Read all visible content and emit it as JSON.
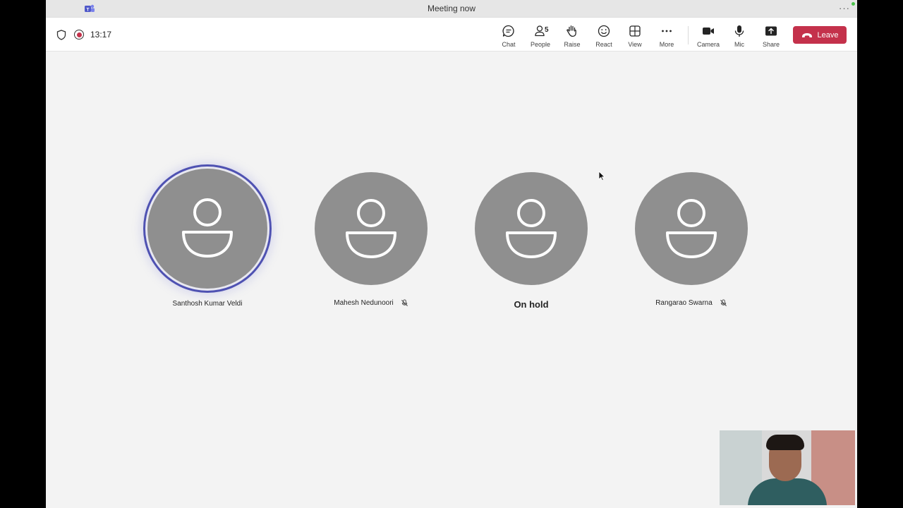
{
  "titlebar": {
    "title": "Meeting now"
  },
  "toolbar": {
    "timer": "13:17",
    "buttons": [
      {
        "label": "Chat",
        "icon": "chat-icon"
      },
      {
        "label": "People",
        "icon": "people-icon",
        "count": "5"
      },
      {
        "label": "Raise",
        "icon": "raise-hand-icon"
      },
      {
        "label": "React",
        "icon": "react-icon"
      },
      {
        "label": "View",
        "icon": "view-icon"
      },
      {
        "label": "More",
        "icon": "more-icon"
      },
      {
        "label": "Camera",
        "icon": "camera-icon"
      },
      {
        "label": "Mic",
        "icon": "mic-icon"
      },
      {
        "label": "Share",
        "icon": "share-icon"
      }
    ],
    "leave_label": "Leave"
  },
  "participants": [
    {
      "name": "Santhosh Kumar Veldi",
      "speaking": true,
      "muted": false
    },
    {
      "name": "Mahesh Nedunoori",
      "speaking": false,
      "muted": true
    },
    {
      "name": "On hold",
      "speaking": false,
      "muted": false
    },
    {
      "name": "Rangarao Swarna",
      "speaking": false,
      "muted": true
    }
  ],
  "colors": {
    "accent": "#4f52b2",
    "leave": "#c4314b",
    "avatar": "#8f8f8f"
  }
}
